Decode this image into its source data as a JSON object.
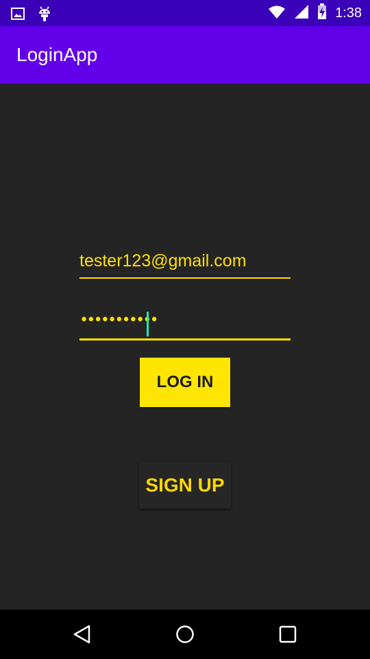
{
  "status_bar": {
    "time": "1:38",
    "icons": [
      "gallery-icon",
      "android-icon",
      "wifi-icon",
      "signal-icon",
      "battery-charging-icon"
    ]
  },
  "app_bar": {
    "title": "LoginApp"
  },
  "form": {
    "email_value": "tester123@gmail.com",
    "password_value": "•••••••••••",
    "login_label": "LOG IN",
    "signup_label": "SIGN UP"
  },
  "nav_bar": {
    "icons": [
      "back-icon",
      "home-icon",
      "recents-icon"
    ]
  },
  "colors": {
    "status_bar": "#3a01b8",
    "app_bar": "#6200ea",
    "background": "#242424",
    "accent": "#ffe500",
    "caret": "#1de9b6"
  }
}
